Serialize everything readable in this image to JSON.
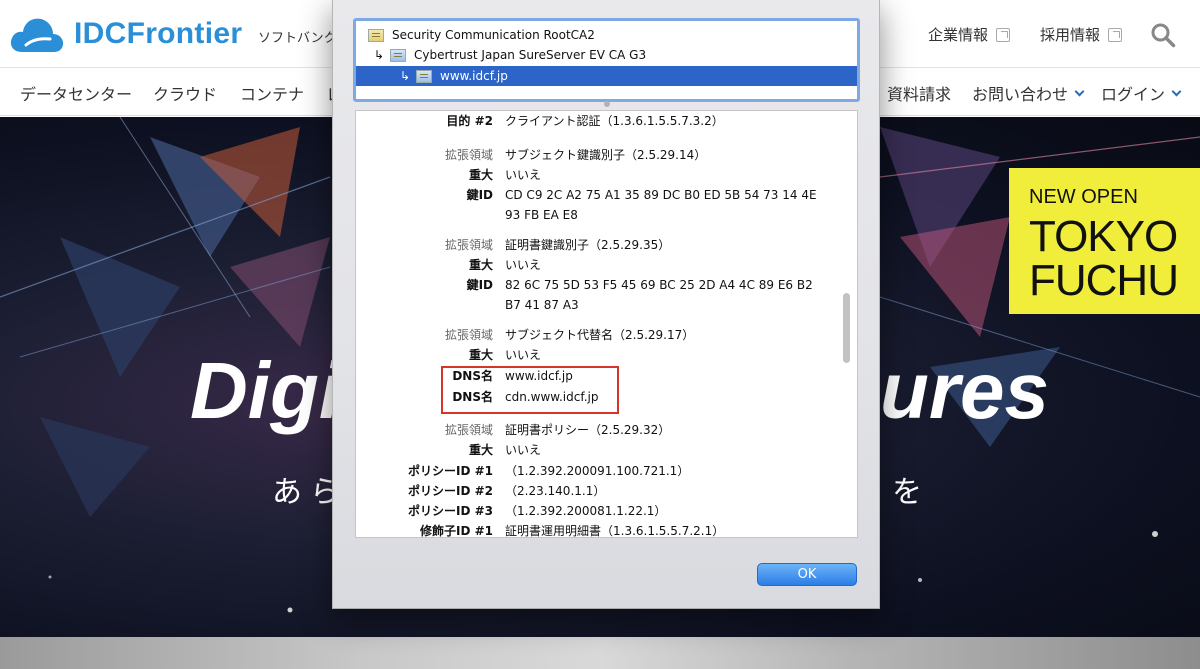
{
  "site": {
    "logo_text": "IDCFrontier",
    "tagline": "ソフトバンク",
    "header_links": [
      "企業情報",
      "採用情報"
    ],
    "nav_left": [
      "データセンター",
      "クラウド",
      "コンテナ",
      "レ"
    ],
    "nav_right": [
      "資料請求",
      "お問い合わせ",
      "ログイン"
    ]
  },
  "hero": {
    "title_left": "Digi",
    "title_right": "ures",
    "sub_left": "あら",
    "sub_right": "を",
    "promo": {
      "small": "NEW OPEN",
      "line1": "TOKYO",
      "line2": "FUCHU"
    }
  },
  "dialog": {
    "chain": [
      {
        "name": "Security Communication RootCA2"
      },
      {
        "name": "Cybertrust Japan SureServer EV CA G3"
      },
      {
        "name": "www.idcf.jp"
      }
    ],
    "details": [
      {
        "label": "目的 #2",
        "value": "クライアント認証（1.3.6.1.5.5.7.3.2）"
      },
      {
        "label": "拡張領域",
        "value": "サブジェクト鍵識別子（2.5.29.14）"
      },
      {
        "label": "重大",
        "value": "いいえ"
      },
      {
        "label": "鍵ID",
        "value": "CD C9 2C A2 75 A1 35 89 DC B0 ED 5B 54 73 14 4E 93 FB EA E8"
      },
      {
        "label": "拡張領域",
        "value": "証明書鍵識別子（2.5.29.35）"
      },
      {
        "label": "重大",
        "value": "いいえ"
      },
      {
        "label": "鍵ID",
        "value": "82 6C 75 5D 53 F5 45 69 BC 25 2D A4 4C 89 E6 B2 B7 41 87 A3"
      },
      {
        "label": "拡張領域",
        "value": "サブジェクト代替名（2.5.29.17）"
      },
      {
        "label": "重大",
        "value": "いいえ"
      },
      {
        "label": "DNS名",
        "value": "www.idcf.jp"
      },
      {
        "label": "DNS名",
        "value": "cdn.www.idcf.jp"
      },
      {
        "label": "拡張領域",
        "value": "証明書ポリシー（2.5.29.32）"
      },
      {
        "label": "重大",
        "value": "いいえ"
      },
      {
        "label": "ポリシーID #1",
        "value": "（1.2.392.200091.100.721.1）"
      },
      {
        "label": "ポリシーID #2",
        "value": "（2.23.140.1.1）"
      },
      {
        "label": "ポリシーID #3",
        "value": "（1.2.392.200081.1.22.1）"
      },
      {
        "label": "修飾子ID #1",
        "value": "証明書運用明細書（1.3.6.1.5.5.7.2.1）"
      }
    ],
    "ok_label": "OK"
  },
  "colors": {
    "brand": "#2a8fd6",
    "selection": "#2d64c8",
    "highlight": "#d8342a",
    "promo": "#f0ee3a"
  }
}
